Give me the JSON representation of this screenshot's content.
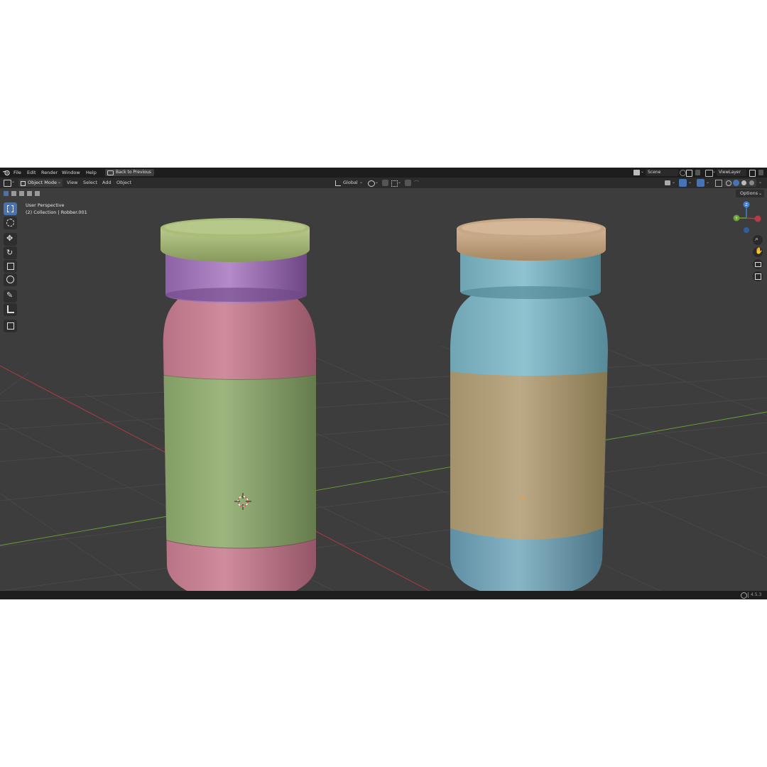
{
  "menu": {
    "file": "File",
    "edit": "Edit",
    "render": "Render",
    "window": "Window",
    "help": "Help",
    "back": "Back to Previous"
  },
  "scene": {
    "name": "Scene",
    "view_layer": "ViewLayer"
  },
  "header": {
    "mode": "Object Mode",
    "view": "View",
    "select": "Select",
    "add": "Add",
    "object": "Object",
    "orientation": "Global",
    "options": "Options"
  },
  "viewport": {
    "perspective": "User Perspective",
    "collection": "(2) Collection | Robber.001"
  },
  "status": {
    "version": "4.5.3"
  },
  "colors": {
    "accent": "#4772b3",
    "viewport_bg": "#3d3d3d",
    "x_axis": "#b83a46",
    "y_axis": "#6aa336",
    "z_axis": "#3f82d7"
  },
  "icons": [
    "blender-logo-icon",
    "editor-type-icon",
    "select-box-icon",
    "cursor-icon",
    "move-icon",
    "rotate-icon",
    "scale-icon",
    "transform-icon",
    "annotate-icon",
    "measure-icon",
    "add-cube-icon",
    "zoom-icon",
    "pan-hand-icon",
    "camera-icon",
    "grid-icon",
    "globe-icon"
  ]
}
